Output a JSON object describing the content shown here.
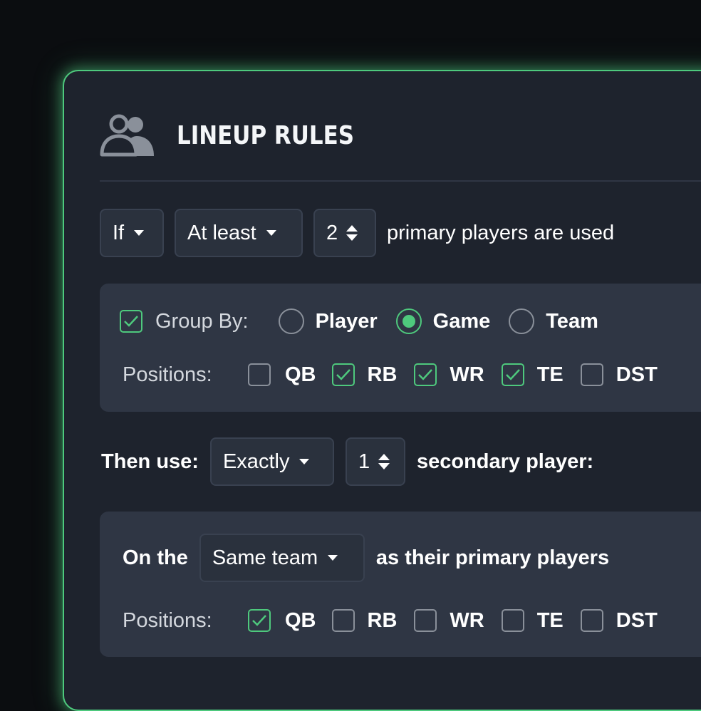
{
  "title": "LINEUP RULES",
  "rule": {
    "condition": "If",
    "comparator": "At least",
    "count": "2",
    "suffix": "primary players are used"
  },
  "group": {
    "checkbox_label": "Group By:",
    "options": [
      {
        "label": "Player",
        "selected": false
      },
      {
        "label": "Game",
        "selected": true
      },
      {
        "label": "Team",
        "selected": false
      }
    ],
    "positions_label": "Positions:",
    "positions": [
      {
        "label": "QB",
        "checked": false
      },
      {
        "label": "RB",
        "checked": true
      },
      {
        "label": "WR",
        "checked": true
      },
      {
        "label": "TE",
        "checked": true
      },
      {
        "label": "DST",
        "checked": false
      }
    ]
  },
  "then": {
    "label": "Then use:",
    "comparator": "Exactly",
    "count": "1",
    "suffix": "secondary player:"
  },
  "secondary": {
    "prefix": "On the",
    "relation": "Same team",
    "suffix": "as their primary players",
    "positions_label": "Positions:",
    "positions": [
      {
        "label": "QB",
        "checked": true
      },
      {
        "label": "RB",
        "checked": false
      },
      {
        "label": "WR",
        "checked": false
      },
      {
        "label": "TE",
        "checked": false
      },
      {
        "label": "DST",
        "checked": false
      }
    ]
  },
  "colors": {
    "accent": "#4ec97d",
    "panel": "#1e232d",
    "section": "#2f3644"
  }
}
